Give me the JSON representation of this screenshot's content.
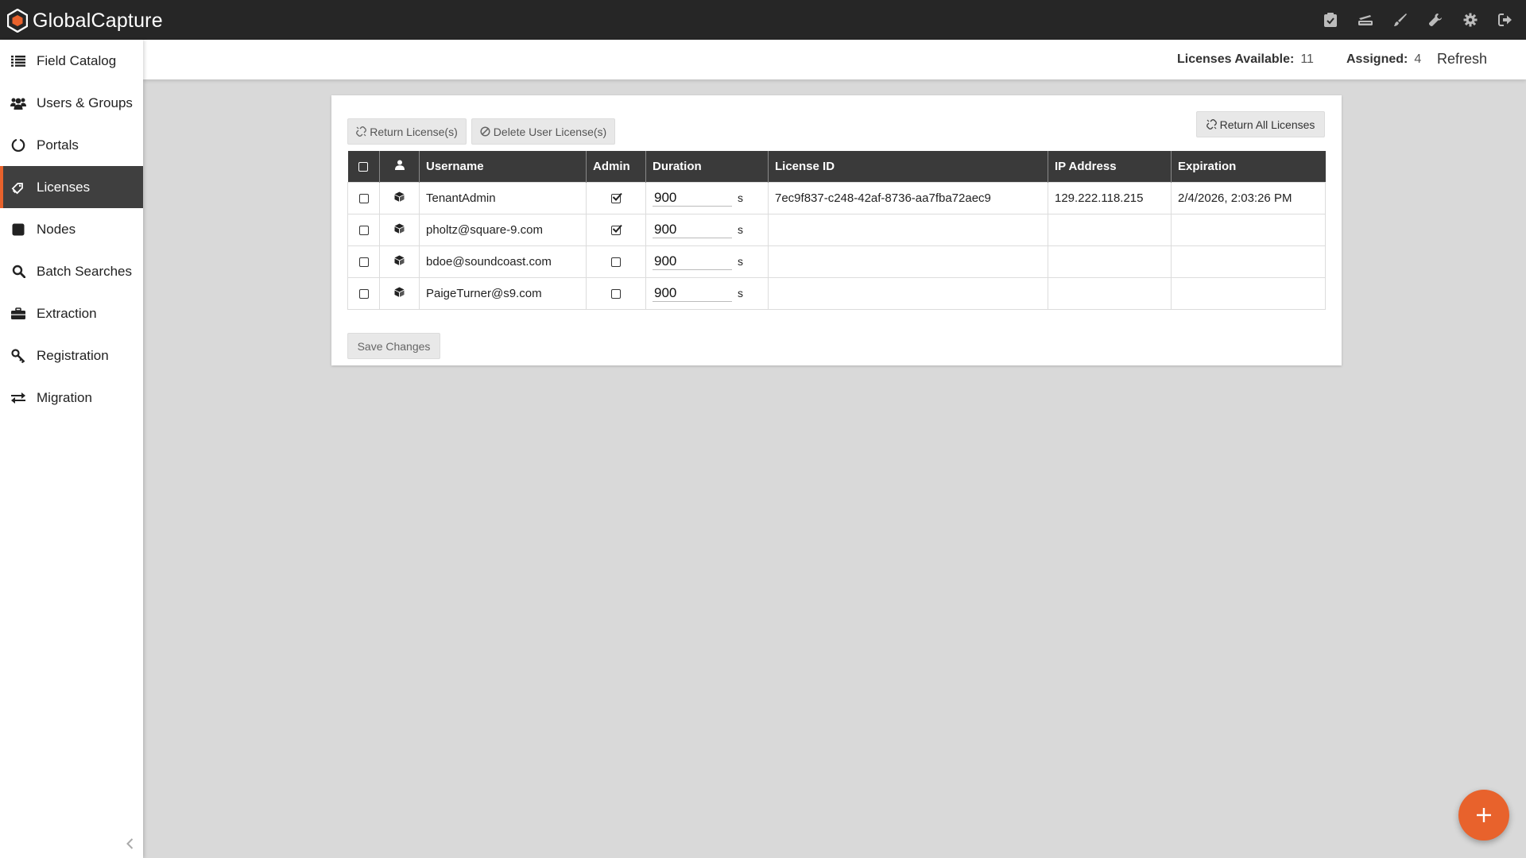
{
  "app": {
    "title": "GlobalCapture",
    "accent_color": "#e8622c",
    "topbar_color": "#262626"
  },
  "topbar": {
    "icons": [
      "tasks-icon",
      "scanner-icon",
      "brush-icon",
      "wrench-icon",
      "gear-icon",
      "logout-icon"
    ]
  },
  "sidebar": {
    "items": [
      {
        "label": "Field Catalog",
        "icon": "list-icon",
        "active": false
      },
      {
        "label": "Users & Groups",
        "icon": "users-icon",
        "active": false
      },
      {
        "label": "Portals",
        "icon": "circle-notch-icon",
        "active": false
      },
      {
        "label": "Licenses",
        "icon": "tag-icon",
        "active": true
      },
      {
        "label": "Nodes",
        "icon": "square-icon",
        "active": false
      },
      {
        "label": "Batch Searches",
        "icon": "search-icon",
        "active": false
      },
      {
        "label": "Extraction",
        "icon": "briefcase-icon",
        "active": false
      },
      {
        "label": "Registration",
        "icon": "key-icon",
        "active": false
      },
      {
        "label": "Migration",
        "icon": "exchange-icon",
        "active": false
      }
    ]
  },
  "stats": {
    "available_label": "Licenses Available:",
    "available_value": "11",
    "assigned_label": "Assigned:",
    "assigned_value": "4",
    "refresh_label": "Refresh"
  },
  "toolbar": {
    "return_label": "Return License(s)",
    "delete_label": "Delete User License(s)",
    "return_all_label": "Return All Licenses",
    "save_label": "Save Changes"
  },
  "table": {
    "columns": [
      "",
      "",
      "Username",
      "Admin",
      "Duration",
      "License ID",
      "IP Address",
      "Expiration"
    ],
    "duration_unit": "s",
    "rows": [
      {
        "username": "TenantAdmin",
        "admin": true,
        "duration": "900",
        "license_id": "7ec9f837-c248-42af-8736-aa7fba72aec9",
        "ip": "129.222.118.215",
        "expiration": "2/4/2026, 2:03:26 PM"
      },
      {
        "username": "pholtz@square-9.com",
        "admin": true,
        "duration": "900",
        "license_id": "",
        "ip": "",
        "expiration": ""
      },
      {
        "username": "bdoe@soundcoast.com",
        "admin": false,
        "duration": "900",
        "license_id": "",
        "ip": "",
        "expiration": ""
      },
      {
        "username": "PaigeTurner@s9.com",
        "admin": false,
        "duration": "900",
        "license_id": "",
        "ip": "",
        "expiration": ""
      }
    ]
  }
}
